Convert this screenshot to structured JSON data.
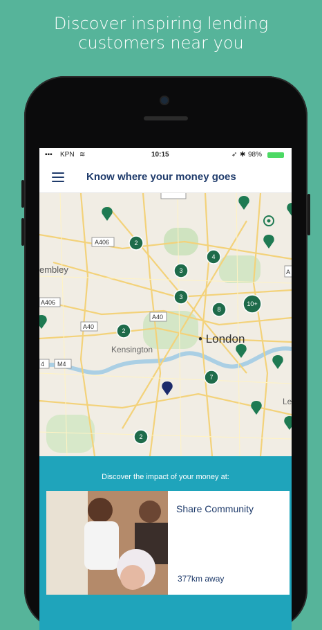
{
  "headline": {
    "line1": "Discover inspiring lending",
    "line2": "customers near you"
  },
  "status_bar": {
    "carrier": "KPN",
    "time": "10:15",
    "battery": "98%"
  },
  "nav": {
    "title": "Know where your money goes"
  },
  "map": {
    "labels": {
      "london": "London",
      "kensington": "Kensington",
      "wembley": "embley",
      "a406_top": "A406",
      "a406_left": "A406",
      "a40_left": "A40",
      "a40_center": "A40",
      "m4": "M4",
      "four": "4",
      "le": "Le",
      "a_right": "A"
    },
    "clusters": [
      "2",
      "3",
      "4",
      "3",
      "8",
      "10+",
      "2",
      "7",
      "2"
    ]
  },
  "bottom": {
    "title": "Discover the impact of your money at:",
    "card": {
      "name": "Share Community",
      "distance": "377km away"
    }
  },
  "colors": {
    "background": "#56b49a",
    "accent": "#1f3b6b",
    "cluster": "#1e6b4a",
    "panel": "#1fa4bb"
  }
}
